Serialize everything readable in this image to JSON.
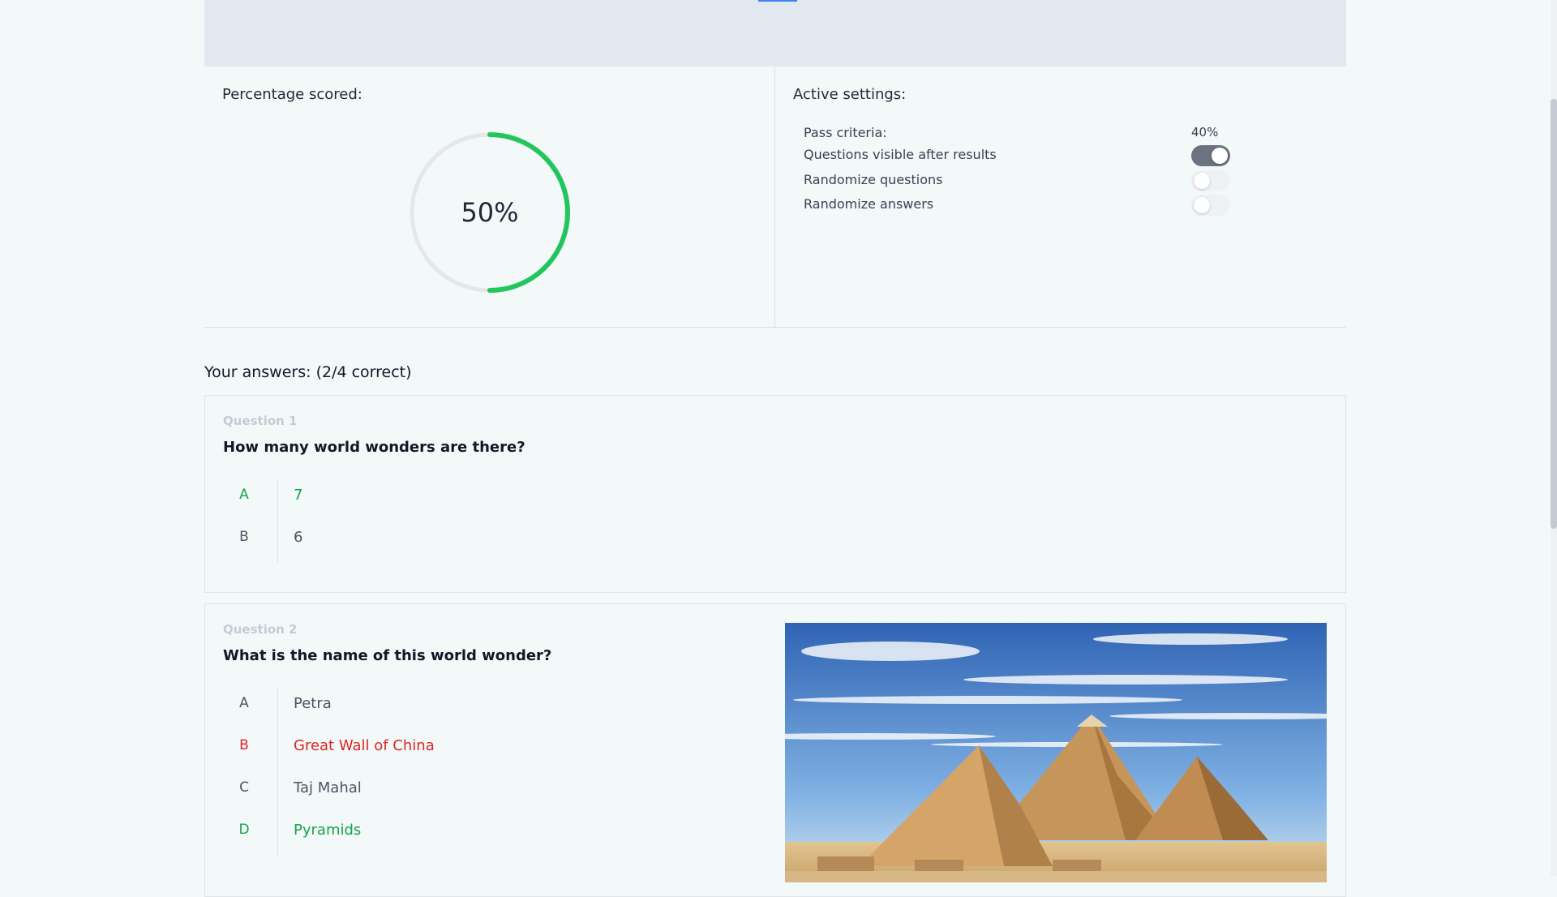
{
  "score_panel": {
    "title": "Percentage scored:",
    "percent_label": "50%",
    "percent_value": 0.5,
    "ring_color": "#22c55e"
  },
  "settings_panel": {
    "title": "Active settings:",
    "pass_criteria": {
      "label": "Pass criteria:",
      "value": "40%"
    },
    "toggles": [
      {
        "label": "Questions visible after results",
        "on": true
      },
      {
        "label": "Randomize questions",
        "on": false
      },
      {
        "label": "Randomize answers",
        "on": false
      }
    ]
  },
  "answers": {
    "heading": "Your answers: (2/4 correct)",
    "questions": [
      {
        "number": "Question 1",
        "text": "How many world wonders are there?",
        "options": [
          {
            "letter": "A",
            "text": "7",
            "state": "correct"
          },
          {
            "letter": "B",
            "text": "6",
            "state": "neutral"
          }
        ]
      },
      {
        "number": "Question 2",
        "text": "What is the name of this world wonder?",
        "options": [
          {
            "letter": "A",
            "text": "Petra",
            "state": "neutral"
          },
          {
            "letter": "B",
            "text": "Great Wall of China",
            "state": "wrong"
          },
          {
            "letter": "C",
            "text": "Taj Mahal",
            "state": "neutral"
          },
          {
            "letter": "D",
            "text": "Pyramids",
            "state": "correct"
          }
        ],
        "image": "pyramids-photo"
      }
    ]
  },
  "colors": {
    "correct": "#16a34a",
    "wrong": "#dc2626",
    "neutral": "#4b5563"
  }
}
